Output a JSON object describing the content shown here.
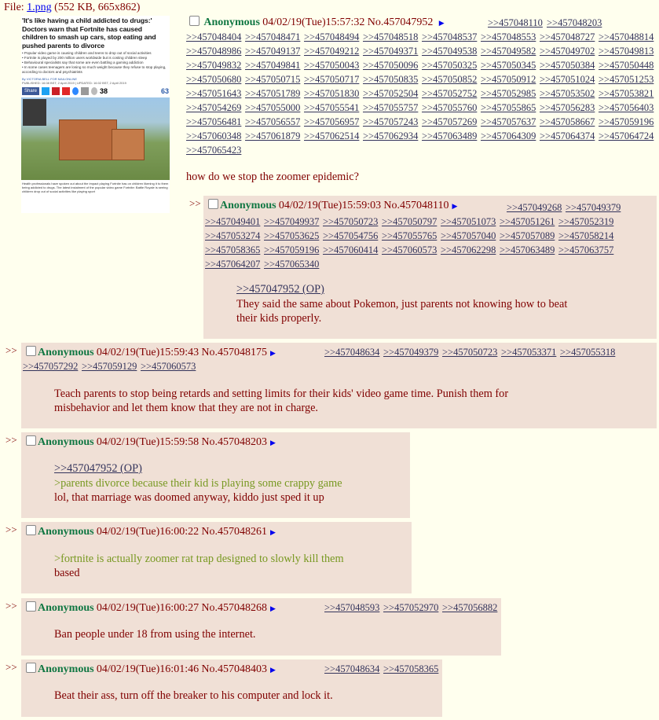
{
  "file": {
    "label": "File:",
    "link": "1.png",
    "meta": "(552 KB, 665x862)"
  },
  "thumb": {
    "headline": "'It's like having a child addicted to drugs:' Doctors warn that Fortnite has caused children to smash up cars, stop eating and pushed parents to divorce",
    "bullets": [
      "• Popular video game is causing children and teens to drop out of social activities",
      "• Fortnite is played by 200 million users worldwide but is costing children sleep",
      "• Behavioural specialists say that some are even battling a gaming addiction",
      "• In some cases teenagers are losing so much weight because they refuse to stop playing, according to doctors and psychiatrists"
    ],
    "byline": "By VICTORIA BELL FOR MAILONLINE",
    "published": "PUBLISHED: 16:08 BST, 2 April 2019 | UPDATED: 16:02 BST, 2 April 2019",
    "share_label": "Share",
    "share_count": "38",
    "comments_count": "63",
    "caption": "Health professionals have spoken out about the impact playing Fortnite has on children likening it to them being addicted to drugs. The latest instalment of the popular video game Fortnite: Battle Royale is seeing children drop out of social activities like playing sport"
  },
  "op": {
    "name": "Anonymous",
    "datetime": "04/02/19(Tue)15:57:32",
    "no": "No.457047952",
    "backlinks": [
      ">>457048110",
      ">>457048203",
      ">>457048404",
      ">>457048471",
      ">>457048494",
      ">>457048518",
      ">>457048537",
      ">>457048553",
      ">>457048727",
      ">>457048814",
      ">>457048986",
      ">>457049137",
      ">>457049212",
      ">>457049371",
      ">>457049538",
      ">>457049582",
      ">>457049702",
      ">>457049813",
      ">>457049832",
      ">>457049841",
      ">>457050043",
      ">>457050096",
      ">>457050325",
      ">>457050345",
      ">>457050384",
      ">>457050448",
      ">>457050680",
      ">>457050715",
      ">>457050717",
      ">>457050835",
      ">>457050852",
      ">>457050912",
      ">>457051024",
      ">>457051253",
      ">>457051643",
      ">>457051789",
      ">>457051830",
      ">>457052504",
      ">>457052752",
      ">>457052985",
      ">>457053502",
      ">>457053821",
      ">>457054269",
      ">>457055000",
      ">>457055541",
      ">>457055757",
      ">>457055760",
      ">>457055865",
      ">>457056283",
      ">>457056403",
      ">>457056481",
      ">>457056557",
      ">>457056957",
      ">>457057243",
      ">>457057269",
      ">>457057637",
      ">>457058667",
      ">>457059196",
      ">>457060348",
      ">>457061879",
      ">>457062514",
      ">>457062934",
      ">>457063489",
      ">>457064309",
      ">>457064374",
      ">>457064724",
      ">>457065423"
    ],
    "text": "how do we stop the zoomer epidemic?"
  },
  "replies": [
    {
      "arrows": ">>",
      "name": "Anonymous",
      "datetime": "04/02/19(Tue)15:59:03",
      "no": "No.457048110",
      "backlinks": [
        ">>457049268",
        ">>457049379",
        ">>457049401",
        ">>457049937",
        ">>457050723",
        ">>457050797",
        ">>457051073",
        ">>457051261",
        ">>457052319",
        ">>457053274",
        ">>457053625",
        ">>457054756",
        ">>457055765",
        ">>457057040",
        ">>457057089",
        ">>457058214",
        ">>457058365",
        ">>457059196",
        ">>457060414",
        ">>457060573",
        ">>457062298",
        ">>457063489",
        ">>457063757",
        ">>457064207",
        ">>457065340"
      ],
      "oplink": ">>457047952 (OP)",
      "text": [
        "They said the same about Pokemon, just parents not knowing how to beat",
        "their kids properly."
      ]
    },
    {
      "arrows": ">>",
      "name": "Anonymous",
      "datetime": "04/02/19(Tue)15:59:43",
      "no": "No.457048175",
      "backlinks": [
        ">>457048634",
        ">>457049379",
        ">>457050723",
        ">>457053371",
        ">>457055318",
        ">>457057292",
        ">>457059129",
        ">>457060573"
      ],
      "text": [
        "Teach parents to stop being retards and setting limits for their kids' video game time. Punish them for",
        "misbehavior and let them know that they are not in charge."
      ]
    },
    {
      "arrows": ">>",
      "name": "Anonymous",
      "datetime": "04/02/19(Tue)15:59:58",
      "no": "No.457048203",
      "oplink": ">>457047952 (OP)",
      "greentext": ">parents divorce because their kid is playing some crappy game",
      "text": [
        "lol, that marriage was doomed anyway, kiddo just sped it up"
      ]
    },
    {
      "arrows": ">>",
      "name": "Anonymous",
      "datetime": "04/02/19(Tue)16:00:22",
      "no": "No.457048261",
      "greentext": ">fortnite is actually zoomer rat trap designed to slowly kill them",
      "text": [
        "based"
      ]
    },
    {
      "arrows": ">>",
      "name": "Anonymous",
      "datetime": "04/02/19(Tue)16:00:27",
      "no": "No.457048268",
      "backlinks": [
        ">>457048593",
        ">>457052970",
        ">>457056882"
      ],
      "text": [
        "Ban people under 18 from using the internet."
      ]
    },
    {
      "arrows": ">>",
      "name": "Anonymous",
      "datetime": "04/02/19(Tue)16:01:46",
      "no": "No.457048403",
      "backlinks": [
        ">>457048634",
        ">>457058365"
      ],
      "text": [
        "Beat their ass, turn off the breaker to his computer and lock it."
      ]
    }
  ]
}
